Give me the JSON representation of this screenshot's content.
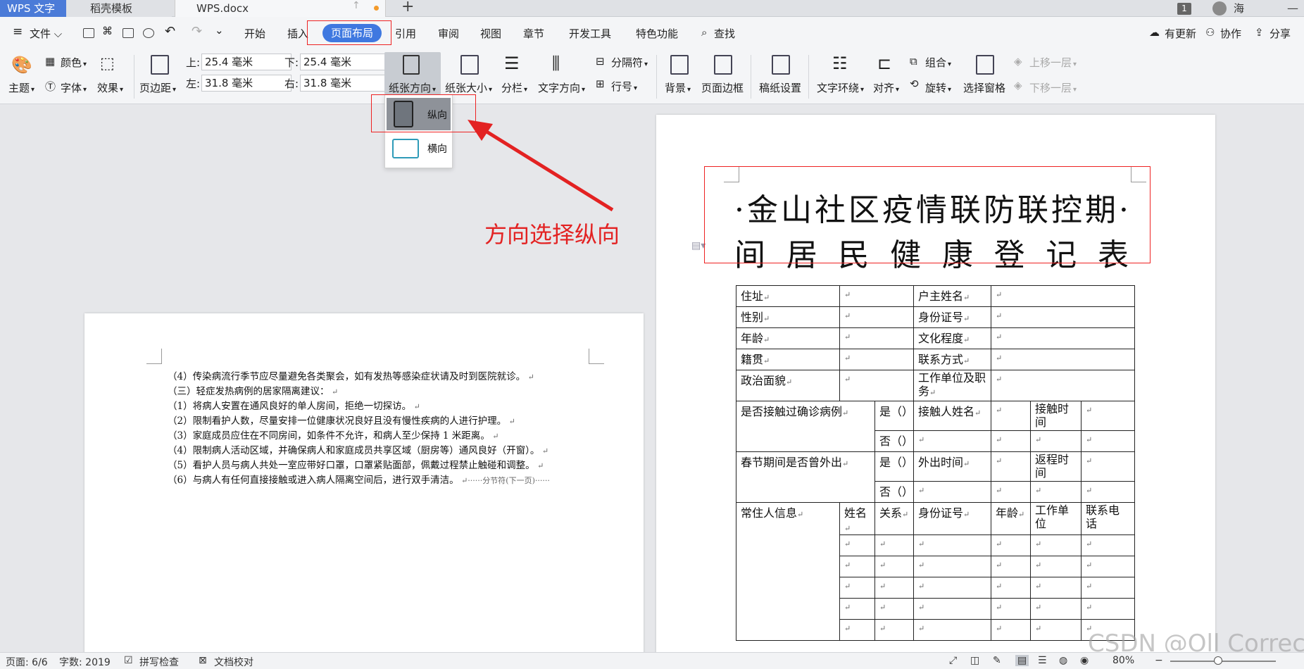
{
  "tabs": {
    "app": "WPS 文字",
    "template": "稻壳模板",
    "document": "WPS.docx",
    "badge": "1",
    "user": "海"
  },
  "menu": {
    "file": "文件",
    "items": [
      "开始",
      "插入",
      "页面布局",
      "引用",
      "审阅",
      "视图",
      "章节",
      "开发工具",
      "特色功能"
    ],
    "search": "查找",
    "right": [
      "有更新",
      "协作",
      "分享"
    ]
  },
  "ribbon": {
    "theme": "主题",
    "color": "颜色",
    "font": "字体",
    "effect": "效果",
    "margin": "页边距",
    "top_label": "上:",
    "top_value": "25.4 毫米",
    "bottom_label": "下:",
    "bottom_value": "25.4 毫米",
    "left_label": "左:",
    "left_value": "31.8 毫米",
    "right_label": "右:",
    "right_value": "31.8 毫米",
    "orientation": "纸张方向",
    "paper_size": "纸张大小",
    "columns": "分栏",
    "text_direction": "文字方向",
    "separator": "分隔符",
    "line_number": "行号",
    "background": "背景",
    "page_border": "页面边框",
    "grid_paper": "稿纸设置",
    "wrap": "文字环绕",
    "align": "对齐",
    "group": "组合",
    "rotate": "旋转",
    "selection_pane": "选择窗格",
    "bring_forward": "上移一层",
    "send_backward": "下移一层"
  },
  "dropdown": {
    "portrait": "纵向",
    "landscape": "横向"
  },
  "annotation": "方向选择纵向",
  "left_page_lines": [
    "（4）传染病流行季节应尽量避免各类聚会，如有发热等感染症状请及时到医院就诊。",
    "（三）轻症发热病例的居家隔离建议：",
    "（1）将病人安置在通风良好的单人房间，拒绝一切探访。",
    "（2）限制看护人数，尽量安排一位健康状况良好且没有慢性疾病的人进行护理。",
    "（3）家庭成员应住在不同房间，如条件不允许，和病人至少保持 1 米距离。",
    "（4）限制病人活动区域，并确保病人和家庭成员共享区域（厨房等）通风良好（开窗）。",
    "（5）看护人员与病人共处一室应带好口罩，口罩紧贴面部，佩戴过程禁止触碰和调整。",
    "（6）与病人有任何直接接触或进入病人隔离空间后，进行双手清洁。"
  ],
  "section_break": "分节符(下一页)",
  "doc_title_line1": "·金山社区疫情联防联控期·",
  "doc_title_line2": "间居民健康登记表",
  "table": {
    "address": "住址",
    "householder": "户主姓名",
    "gender": "性别",
    "id_number": "身份证号",
    "age": "年龄",
    "education": "文化程度",
    "native": "籍贯",
    "contact": "联系方式",
    "political": "政治面貌",
    "workplace": "工作单位及职务",
    "contacted_q": "是否接触过确诊病例",
    "yes": "是（）",
    "no": "否（）",
    "contact_name": "接触人姓名",
    "contact_time": "接触时间",
    "traveled_q": "春节期间是否曾外出",
    "out_time": "外出时间",
    "return_time": "返程时间",
    "residents": "常住人信息",
    "name": "姓名",
    "relation": "关系",
    "r_id": "身份证号",
    "r_age": "年龄",
    "r_work": "工作单位",
    "r_phone": "联系电话",
    "mark": "↵"
  },
  "status": {
    "page": "页面: 6/6",
    "words": "字数: 2019",
    "spell": "拼写检查",
    "proof": "文档校对",
    "zoom": "80%"
  },
  "watermark": "CSDN @Oll Correct"
}
